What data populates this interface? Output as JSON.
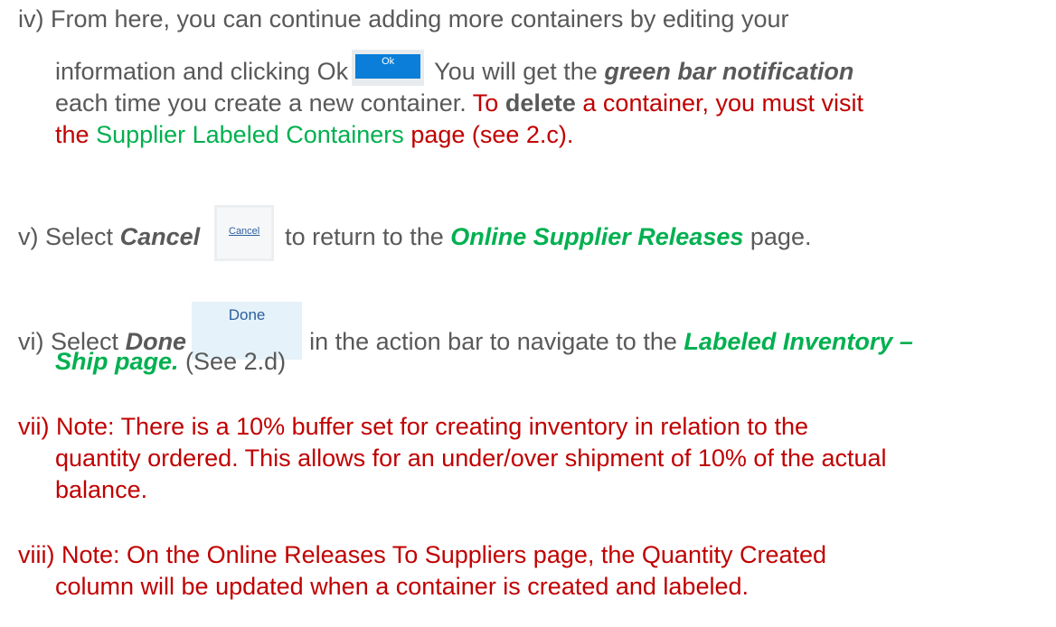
{
  "item_iv": {
    "num": "iv)",
    "line1": "From here, you can continue adding more containers by editing your",
    "line2_pre": "information and clicking Ok",
    "ok_button": "Ok",
    "line2_post": "You will get the",
    "green_bar": "green bar notification",
    "line3": "each time you create a new container.",
    "to_text": "To",
    "delete_text": "delete",
    "delete_rest": "a container, you must visit",
    "the_text": "the",
    "supplier_link": "Supplier Labeled Containers",
    "page_see": "page (see 2.c)."
  },
  "item_v": {
    "num": "v)",
    "select": "Select",
    "cancel_word": "Cancel",
    "cancel_button": "Cancel",
    "to_return": "to return to the",
    "osr": "Online Supplier Releases",
    "page": "page."
  },
  "item_vi": {
    "num": "vi)",
    "select": "Select",
    "done_word": "Done",
    "done_button": "Done",
    "in_action": "in the action bar to navigate to the",
    "labeled_inv": "Labeled Inventory –",
    "ship_page": "Ship page.",
    "see": "(See 2.d)"
  },
  "item_vii": {
    "num": "vii)",
    "line1": "Note: There is a 10% buffer set for creating inventory in relation to the",
    "line2": "quantity ordered. This allows for an under/over shipment of 10% of the actual",
    "line3": "balance."
  },
  "item_viii": {
    "num": "viii)",
    "line1": "Note: On the Online Releases To Suppliers page, the Quantity Created",
    "line2": "column will be updated when a container is created and labeled."
  }
}
